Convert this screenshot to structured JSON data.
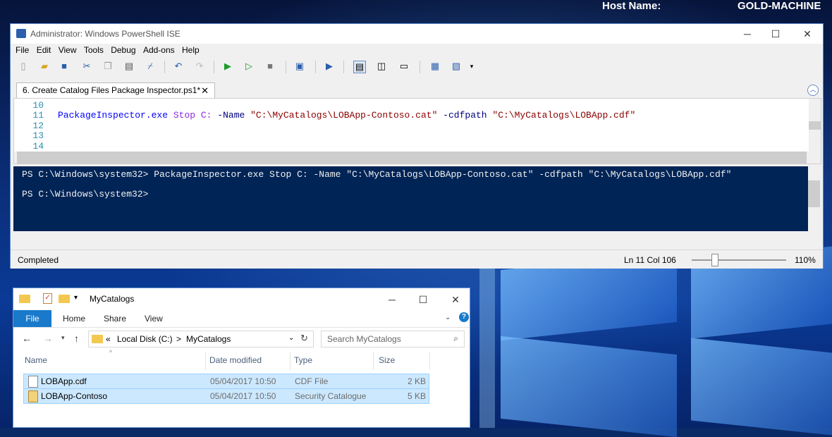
{
  "desktop": {
    "host_label": "Host Name:",
    "host_value": "GOLD-MACHINE"
  },
  "ise": {
    "title": "Administrator: Windows PowerShell ISE",
    "menu": [
      "File",
      "Edit",
      "View",
      "Tools",
      "Debug",
      "Add-ons",
      "Help"
    ],
    "tab_label": "6. Create Catalog Files Package Inspector.ps1*",
    "line_numbers": [
      "10",
      "11",
      "12",
      "13",
      "14"
    ],
    "code": {
      "cmd": "PackageInspector.exe",
      "arg1": "Stop",
      "arg2": "C:",
      "param1": "-Name",
      "str1": "\"C:\\MyCatalogs\\LOBApp-Contoso.cat\"",
      "param2": "-cdfpath",
      "str2": "\"C:\\MyCatalogs\\LOBApp.cdf\""
    },
    "console": {
      "line1": "PS C:\\Windows\\system32> PackageInspector.exe Stop C: -Name \"C:\\MyCatalogs\\LOBApp-Contoso.cat\" -cdfpath \"C:\\MyCatalogs\\LOBApp.cdf\"",
      "line2": "PS C:\\Windows\\system32>"
    },
    "status": {
      "state": "Completed",
      "position": "Ln 11  Col 106",
      "zoom": "110%"
    }
  },
  "explorer": {
    "title": "MyCatalogs",
    "ribbon": {
      "file": "File",
      "home": "Home",
      "share": "Share",
      "view": "View"
    },
    "address": {
      "prefix": "«",
      "drive": "Local Disk (C:)",
      "sep": ">",
      "folder": "MyCatalogs"
    },
    "search_placeholder": "Search MyCatalogs",
    "columns": {
      "name": "Name",
      "date": "Date modified",
      "type": "Type",
      "size": "Size"
    },
    "files": [
      {
        "name": "LOBApp.cdf",
        "date": "05/04/2017 10:50",
        "type": "CDF File",
        "size": "2 KB"
      },
      {
        "name": "LOBApp-Contoso",
        "date": "05/04/2017 10:50",
        "type": "Security Catalogue",
        "size": "5 KB"
      }
    ]
  }
}
